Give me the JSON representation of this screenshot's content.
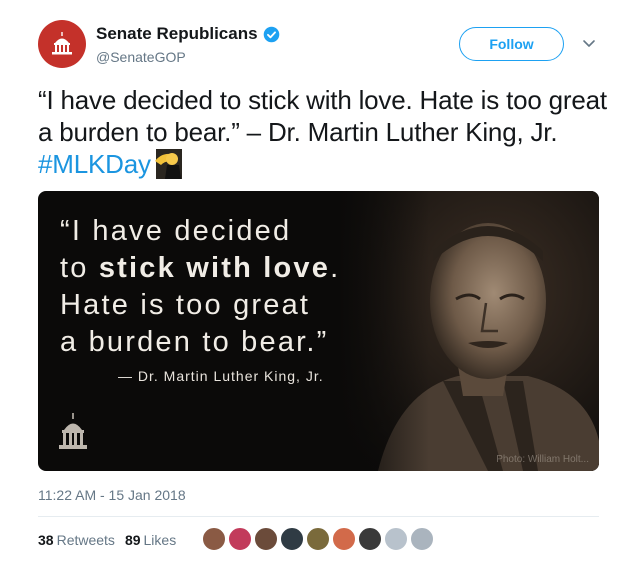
{
  "author": {
    "name": "Senate Republicans",
    "handle": "@SenateGOP",
    "verified": true,
    "avatar_color": "#c4312a"
  },
  "actions": {
    "follow_label": "Follow",
    "menu_icon": "chevron-down-icon"
  },
  "tweet": {
    "text": "“I have decided to stick with love. Hate is too great a burden to bear.” – Dr. Martin Luther King, Jr. ",
    "hashtag": "#MLKDay",
    "emoji": "fist-icon"
  },
  "media": {
    "quote_line1": "“I have decided",
    "quote_line2_prefix": "to ",
    "quote_line2_bold": "stick with love",
    "quote_line2_suffix": ".",
    "quote_line3": "Hate is too great",
    "quote_line4": "a burden to bear.”",
    "attribution": "— Dr. Martin Luther King, Jr.",
    "credit": "Photo: William Holt..."
  },
  "meta": {
    "timestamp": "11:22 AM - 15 Jan 2018",
    "retweets_count": "38",
    "retweets_label": "Retweets",
    "likes_count": "89",
    "likes_label": "Likes"
  },
  "colors": {
    "accent": "#1da1f2",
    "hashtag": "#1b95e0",
    "muted": "#657786"
  },
  "likers": [
    {
      "color": "#8a5a44"
    },
    {
      "color": "#c23b5b"
    },
    {
      "color": "#6b4b3a"
    },
    {
      "color": "#2f3b44"
    },
    {
      "color": "#7a6a3b"
    },
    {
      "color": "#d26a4a"
    },
    {
      "color": "#3a3a3a"
    },
    {
      "color": "#b8c2cc"
    },
    {
      "color": "#aab4be"
    }
  ]
}
